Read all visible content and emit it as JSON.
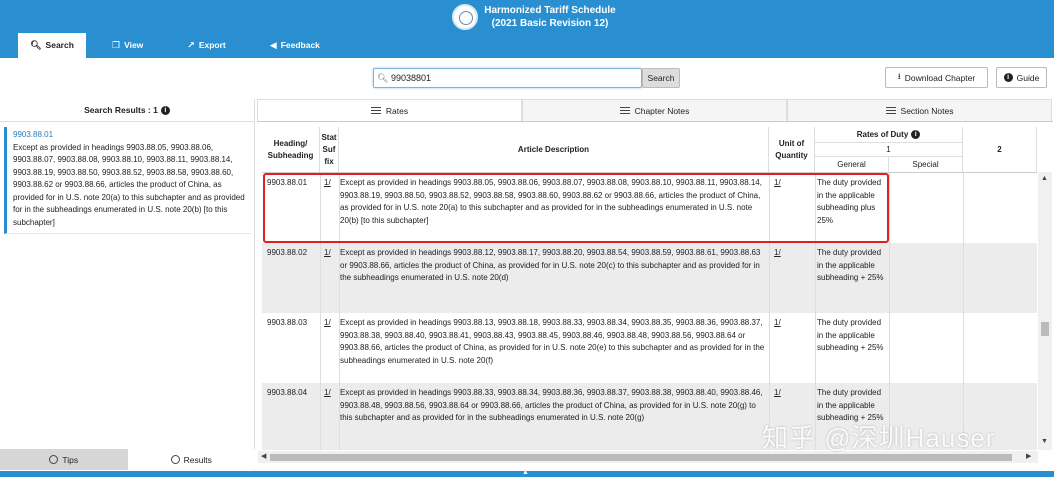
{
  "app": {
    "title_line1": "Harmonized Tariff Schedule",
    "title_line2": "(2021 Basic Revision 12)"
  },
  "nav": {
    "tabs": [
      {
        "label": "Search",
        "icon": "search-icon"
      },
      {
        "label": "View",
        "icon": "document-icon"
      },
      {
        "label": "Export",
        "icon": "export-icon"
      },
      {
        "label": "Feedback",
        "icon": "megaphone-icon"
      }
    ]
  },
  "search": {
    "value": "99038801",
    "button_label": "Search"
  },
  "toolbar": {
    "download_label": "Download Chapter",
    "guide_label": "Guide"
  },
  "left_panel": {
    "header": "Search Results : 1",
    "result": {
      "code": "9903.88.01",
      "text": "Except as provided in headings 9903.88.05, 9903.88.06, 9903.88.07, 9903.88.08, 9903.88.10, 9903.88.11, 9903.88.14, 9903.88.19, 9903.88.50, 9903.88.52, 9903.88.58, 9903.88.60, 9903.88.62 or 9903.88.66, articles the product of China, as provided for in U.S. note 20(a) to this subchapter and as provided for in the subheadings enumerated in U.S. note 20(b) [to this subchapter]"
    },
    "footer_tabs": [
      "Tips",
      "Results"
    ]
  },
  "right_tabs": [
    "Rates",
    "Chapter Notes",
    "Section Notes"
  ],
  "table": {
    "headers": {
      "heading": "Heading/ Subheading",
      "suffix": "Stat Suf fix",
      "description": "Article Description",
      "unit": "Unit of Quantity",
      "rates": "Rates of Duty",
      "col1": "1",
      "general": "General",
      "special": "Special",
      "col2": "2"
    },
    "rows": [
      {
        "code": "9903.88.01",
        "suffix": "1/",
        "description": "Except as provided in headings 9903.88.05, 9903.88.06, 9903.88.07, 9903.88.08, 9903.88.10, 9903.88.11, 9903.88.14, 9903.88.19, 9903.88.50, 9903.88.52, 9903.88.58, 9903.88.60, 9903.88.62 or 9903.88.66, articles the product of China, as provided for in U.S. note 20(a) to this subchapter and as provided for in the subheadings enumerated in U.S. note 20(b) [to this subchapter]",
        "unit": "1/",
        "general": "The duty provided in the applicable subheading plus 25%"
      },
      {
        "code": "9903.88.02",
        "suffix": "1/",
        "description": "Except as provided in headings 9903.88.12, 9903.88.17, 9903.88.20, 9903.88.54, 9903.88.59, 9903.88.61, 9903.88.63 or 9903.88.66, articles the product of China, as provided for in U.S. note 20(c) to this subchapter and as provided for in the subheadings enumerated in U.S. note 20(d)",
        "unit": "1/",
        "general": "The duty provided in the applicable subheading + 25%"
      },
      {
        "code": "9903.88.03",
        "suffix": "1/",
        "description": "Except as provided in headings 9903.88.13, 9903.88.18, 9903.88.33, 9903.88.34, 9903.88.35, 9903.88.36, 9903.88.37, 9903.88.38, 9903.88.40, 9903.88.41, 9903.88.43, 9903.88.45, 9903.88.46, 9903.88.48, 9903.88.56, 9903.88.64 or 9903.88.66, articles the product of China, as provided for in U.S. note 20(e) to this subchapter and as provided for in the subheadings enumerated in U.S. note 20(f)",
        "unit": "1/",
        "general": "The duty provided in the applicable subheading + 25%"
      },
      {
        "code": "9903.88.04",
        "suffix": "1/",
        "description": "Except as provided in headings 9903.88.33, 9903.88.34, 9903.88.36, 9903.88.37, 9903.88.38, 9903.88.40, 9903.88.46, 9903.88.48, 9903.88.56, 9903.88.64 or 9903.88.66, articles the product of China, as provided for in U.S. note 20(g) to this subchapter and as provided for in the subheadings enumerated in U.S. note 20(g)",
        "unit": "1/",
        "general": "The duty provided in the applicable subheading + 25%"
      }
    ]
  },
  "watermark": "知乎 @深圳Hauser"
}
